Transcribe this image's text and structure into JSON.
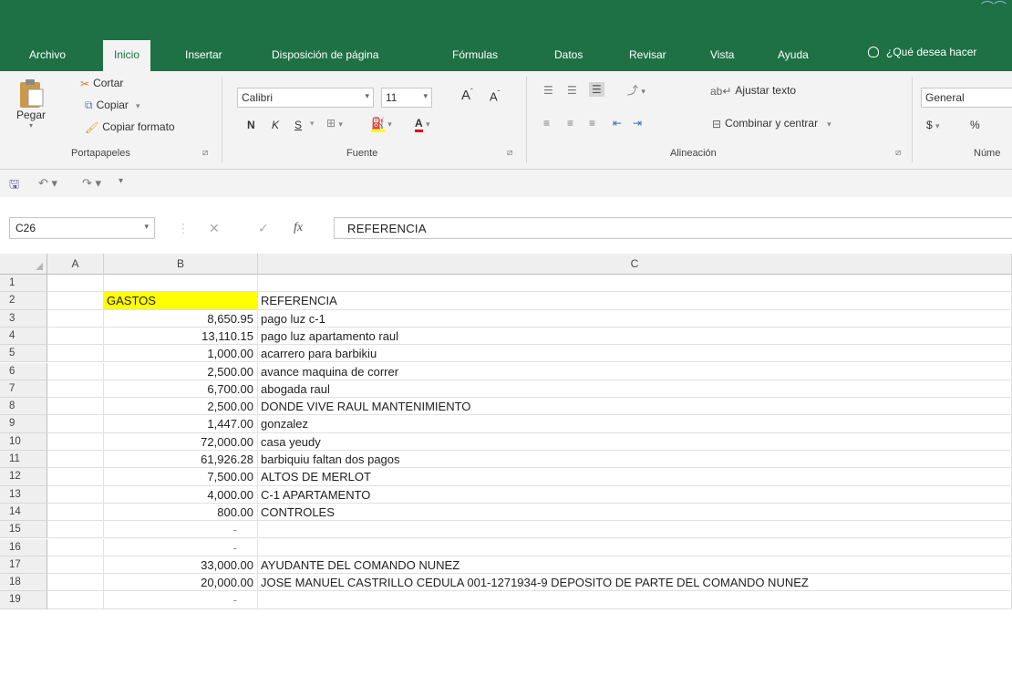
{
  "tabs": [
    "Archivo",
    "Inicio",
    "Insertar",
    "Disposición de página",
    "Fórmulas",
    "Datos",
    "Revisar",
    "Vista",
    "Ayuda"
  ],
  "help_search": "¿Qué desea hacer",
  "ribbon": {
    "clipboard": {
      "paste": "Pegar",
      "cut": "Cortar",
      "copy": "Copiar",
      "format_painter": "Copiar formato",
      "label": "Portapapeles"
    },
    "font": {
      "name": "Calibri",
      "size": "11",
      "bold": "N",
      "italic": "K",
      "underline": "S",
      "label": "Fuente"
    },
    "alignment": {
      "wrap": "Ajustar texto",
      "merge": "Combinar y centrar",
      "label": "Alineación"
    },
    "number": {
      "format": "General",
      "currency": "$",
      "percent": "%",
      "label": "Núme"
    }
  },
  "formula_bar": {
    "name_box": "C26",
    "fx": "fx",
    "value": "REFERENCIA"
  },
  "columns": [
    "A",
    "B",
    "C"
  ],
  "rows": [
    {
      "n": "1",
      "b": "",
      "c": ""
    },
    {
      "n": "2",
      "b": "GASTOS",
      "c": "REFERENCIA"
    },
    {
      "n": "3",
      "b": "8,650.95",
      "c": "pago luz c-1"
    },
    {
      "n": "4",
      "b": "13,110.15",
      "c": "pago luz apartamento raul"
    },
    {
      "n": "5",
      "b": "1,000.00",
      "c": "acarrero para barbikiu"
    },
    {
      "n": "6",
      "b": "2,500.00",
      "c": "avance maquina de correr"
    },
    {
      "n": "7",
      "b": "6,700.00",
      "c": "abogada raul"
    },
    {
      "n": "8",
      "b": "2,500.00",
      "c": "DONDE VIVE RAUL MANTENIMIENTO"
    },
    {
      "n": "9",
      "b": "1,447.00",
      "c": "gonzalez"
    },
    {
      "n": "10",
      "b": "72,000.00",
      "c": "casa yeudy"
    },
    {
      "n": "11",
      "b": "61,926.28",
      "c": "barbiquiu faltan dos pagos"
    },
    {
      "n": "12",
      "b": "7,500.00",
      "c": "ALTOS DE MERLOT"
    },
    {
      "n": "13",
      "b": "4,000.00",
      "c": "C-1 APARTAMENTO"
    },
    {
      "n": "14",
      "b": "800.00",
      "c": "CONTROLES"
    },
    {
      "n": "15",
      "b": "-",
      "c": ""
    },
    {
      "n": "16",
      "b": "-",
      "c": ""
    },
    {
      "n": "17",
      "b": "33,000.00",
      "c": "AYUDANTE DEL COMANDO NUNEZ"
    },
    {
      "n": "18",
      "b": "20,000.00",
      "c": "JOSE MANUEL CASTRILLO CEDULA 001-1271934-9 DEPOSITO DE PARTE DEL COMANDO NUNEZ"
    },
    {
      "n": "19",
      "b": "-",
      "c": ""
    }
  ],
  "colors": {
    "accent": "#1e7145",
    "highlight": "#ffff00"
  }
}
